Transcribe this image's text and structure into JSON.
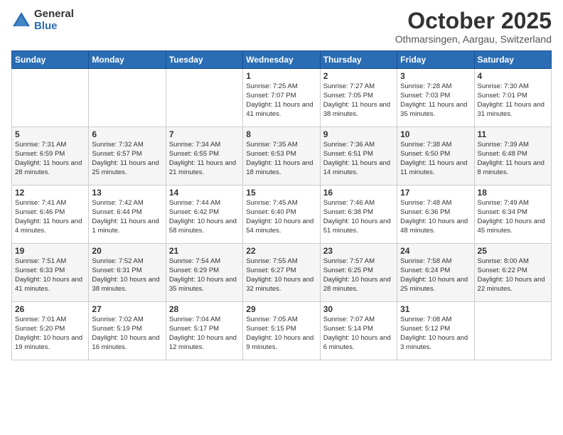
{
  "logo": {
    "general": "General",
    "blue": "Blue"
  },
  "header": {
    "month": "October 2025",
    "location": "Othmarsingen, Aargau, Switzerland"
  },
  "weekdays": [
    "Sunday",
    "Monday",
    "Tuesday",
    "Wednesday",
    "Thursday",
    "Friday",
    "Saturday"
  ],
  "weeks": [
    [
      {
        "day": "",
        "info": ""
      },
      {
        "day": "",
        "info": ""
      },
      {
        "day": "",
        "info": ""
      },
      {
        "day": "1",
        "info": "Sunrise: 7:25 AM\nSunset: 7:07 PM\nDaylight: 11 hours and 41 minutes."
      },
      {
        "day": "2",
        "info": "Sunrise: 7:27 AM\nSunset: 7:05 PM\nDaylight: 11 hours and 38 minutes."
      },
      {
        "day": "3",
        "info": "Sunrise: 7:28 AM\nSunset: 7:03 PM\nDaylight: 11 hours and 35 minutes."
      },
      {
        "day": "4",
        "info": "Sunrise: 7:30 AM\nSunset: 7:01 PM\nDaylight: 11 hours and 31 minutes."
      }
    ],
    [
      {
        "day": "5",
        "info": "Sunrise: 7:31 AM\nSunset: 6:59 PM\nDaylight: 11 hours and 28 minutes."
      },
      {
        "day": "6",
        "info": "Sunrise: 7:32 AM\nSunset: 6:57 PM\nDaylight: 11 hours and 25 minutes."
      },
      {
        "day": "7",
        "info": "Sunrise: 7:34 AM\nSunset: 6:55 PM\nDaylight: 11 hours and 21 minutes."
      },
      {
        "day": "8",
        "info": "Sunrise: 7:35 AM\nSunset: 6:53 PM\nDaylight: 11 hours and 18 minutes."
      },
      {
        "day": "9",
        "info": "Sunrise: 7:36 AM\nSunset: 6:51 PM\nDaylight: 11 hours and 14 minutes."
      },
      {
        "day": "10",
        "info": "Sunrise: 7:38 AM\nSunset: 6:50 PM\nDaylight: 11 hours and 11 minutes."
      },
      {
        "day": "11",
        "info": "Sunrise: 7:39 AM\nSunset: 6:48 PM\nDaylight: 11 hours and 8 minutes."
      }
    ],
    [
      {
        "day": "12",
        "info": "Sunrise: 7:41 AM\nSunset: 6:46 PM\nDaylight: 11 hours and 4 minutes."
      },
      {
        "day": "13",
        "info": "Sunrise: 7:42 AM\nSunset: 6:44 PM\nDaylight: 11 hours and 1 minute."
      },
      {
        "day": "14",
        "info": "Sunrise: 7:44 AM\nSunset: 6:42 PM\nDaylight: 10 hours and 58 minutes."
      },
      {
        "day": "15",
        "info": "Sunrise: 7:45 AM\nSunset: 6:40 PM\nDaylight: 10 hours and 54 minutes."
      },
      {
        "day": "16",
        "info": "Sunrise: 7:46 AM\nSunset: 6:38 PM\nDaylight: 10 hours and 51 minutes."
      },
      {
        "day": "17",
        "info": "Sunrise: 7:48 AM\nSunset: 6:36 PM\nDaylight: 10 hours and 48 minutes."
      },
      {
        "day": "18",
        "info": "Sunrise: 7:49 AM\nSunset: 6:34 PM\nDaylight: 10 hours and 45 minutes."
      }
    ],
    [
      {
        "day": "19",
        "info": "Sunrise: 7:51 AM\nSunset: 6:33 PM\nDaylight: 10 hours and 41 minutes."
      },
      {
        "day": "20",
        "info": "Sunrise: 7:52 AM\nSunset: 6:31 PM\nDaylight: 10 hours and 38 minutes."
      },
      {
        "day": "21",
        "info": "Sunrise: 7:54 AM\nSunset: 6:29 PM\nDaylight: 10 hours and 35 minutes."
      },
      {
        "day": "22",
        "info": "Sunrise: 7:55 AM\nSunset: 6:27 PM\nDaylight: 10 hours and 32 minutes."
      },
      {
        "day": "23",
        "info": "Sunrise: 7:57 AM\nSunset: 6:25 PM\nDaylight: 10 hours and 28 minutes."
      },
      {
        "day": "24",
        "info": "Sunrise: 7:58 AM\nSunset: 6:24 PM\nDaylight: 10 hours and 25 minutes."
      },
      {
        "day": "25",
        "info": "Sunrise: 8:00 AM\nSunset: 6:22 PM\nDaylight: 10 hours and 22 minutes."
      }
    ],
    [
      {
        "day": "26",
        "info": "Sunrise: 7:01 AM\nSunset: 5:20 PM\nDaylight: 10 hours and 19 minutes."
      },
      {
        "day": "27",
        "info": "Sunrise: 7:02 AM\nSunset: 5:19 PM\nDaylight: 10 hours and 16 minutes."
      },
      {
        "day": "28",
        "info": "Sunrise: 7:04 AM\nSunset: 5:17 PM\nDaylight: 10 hours and 12 minutes."
      },
      {
        "day": "29",
        "info": "Sunrise: 7:05 AM\nSunset: 5:15 PM\nDaylight: 10 hours and 9 minutes."
      },
      {
        "day": "30",
        "info": "Sunrise: 7:07 AM\nSunset: 5:14 PM\nDaylight: 10 hours and 6 minutes."
      },
      {
        "day": "31",
        "info": "Sunrise: 7:08 AM\nSunset: 5:12 PM\nDaylight: 10 hours and 3 minutes."
      },
      {
        "day": "",
        "info": ""
      }
    ]
  ]
}
